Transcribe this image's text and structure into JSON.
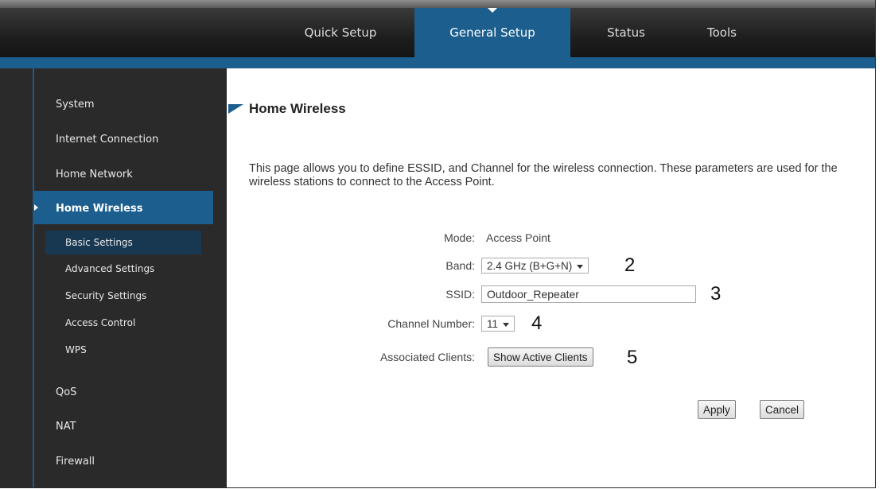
{
  "nav": {
    "tabs": [
      {
        "label": "Quick Setup"
      },
      {
        "label": "General Setup"
      },
      {
        "label": "Status"
      },
      {
        "label": "Tools"
      }
    ]
  },
  "sidebar": {
    "items": [
      {
        "label": "System"
      },
      {
        "label": "Internet Connection"
      },
      {
        "label": "Home Network"
      },
      {
        "label": "Home Wireless"
      },
      {
        "label": "QoS"
      },
      {
        "label": "NAT"
      },
      {
        "label": "Firewall"
      }
    ],
    "subitems": [
      {
        "label": "Basic Settings"
      },
      {
        "label": "Advanced Settings"
      },
      {
        "label": "Security Settings"
      },
      {
        "label": "Access Control"
      },
      {
        "label": "WPS"
      }
    ]
  },
  "content": {
    "title": "Home Wireless",
    "description": "This page allows you to define ESSID, and Channel for the wireless connection. These parameters are used for the wireless stations to connect to the Access Point.",
    "form": {
      "mode_label": "Mode:",
      "mode_value": "Access Point",
      "band_label": "Band:",
      "band_value": "2.4 GHz (B+G+N)",
      "ssid_label": "SSID:",
      "ssid_value": "Outdoor_Repeater",
      "channel_label": "Channel Number:",
      "channel_value": "11",
      "clients_label": "Associated Clients:",
      "clients_button": "Show Active Clients"
    },
    "buttons": {
      "apply": "Apply",
      "cancel": "Cancel"
    },
    "markers": {
      "band": "2",
      "ssid": "3",
      "channel": "4",
      "clients": "5"
    }
  },
  "colors": {
    "accent": "#1c5f8e",
    "sidebar_bg": "#2a2a2a",
    "navbar_bg": "#1e1e1e"
  }
}
